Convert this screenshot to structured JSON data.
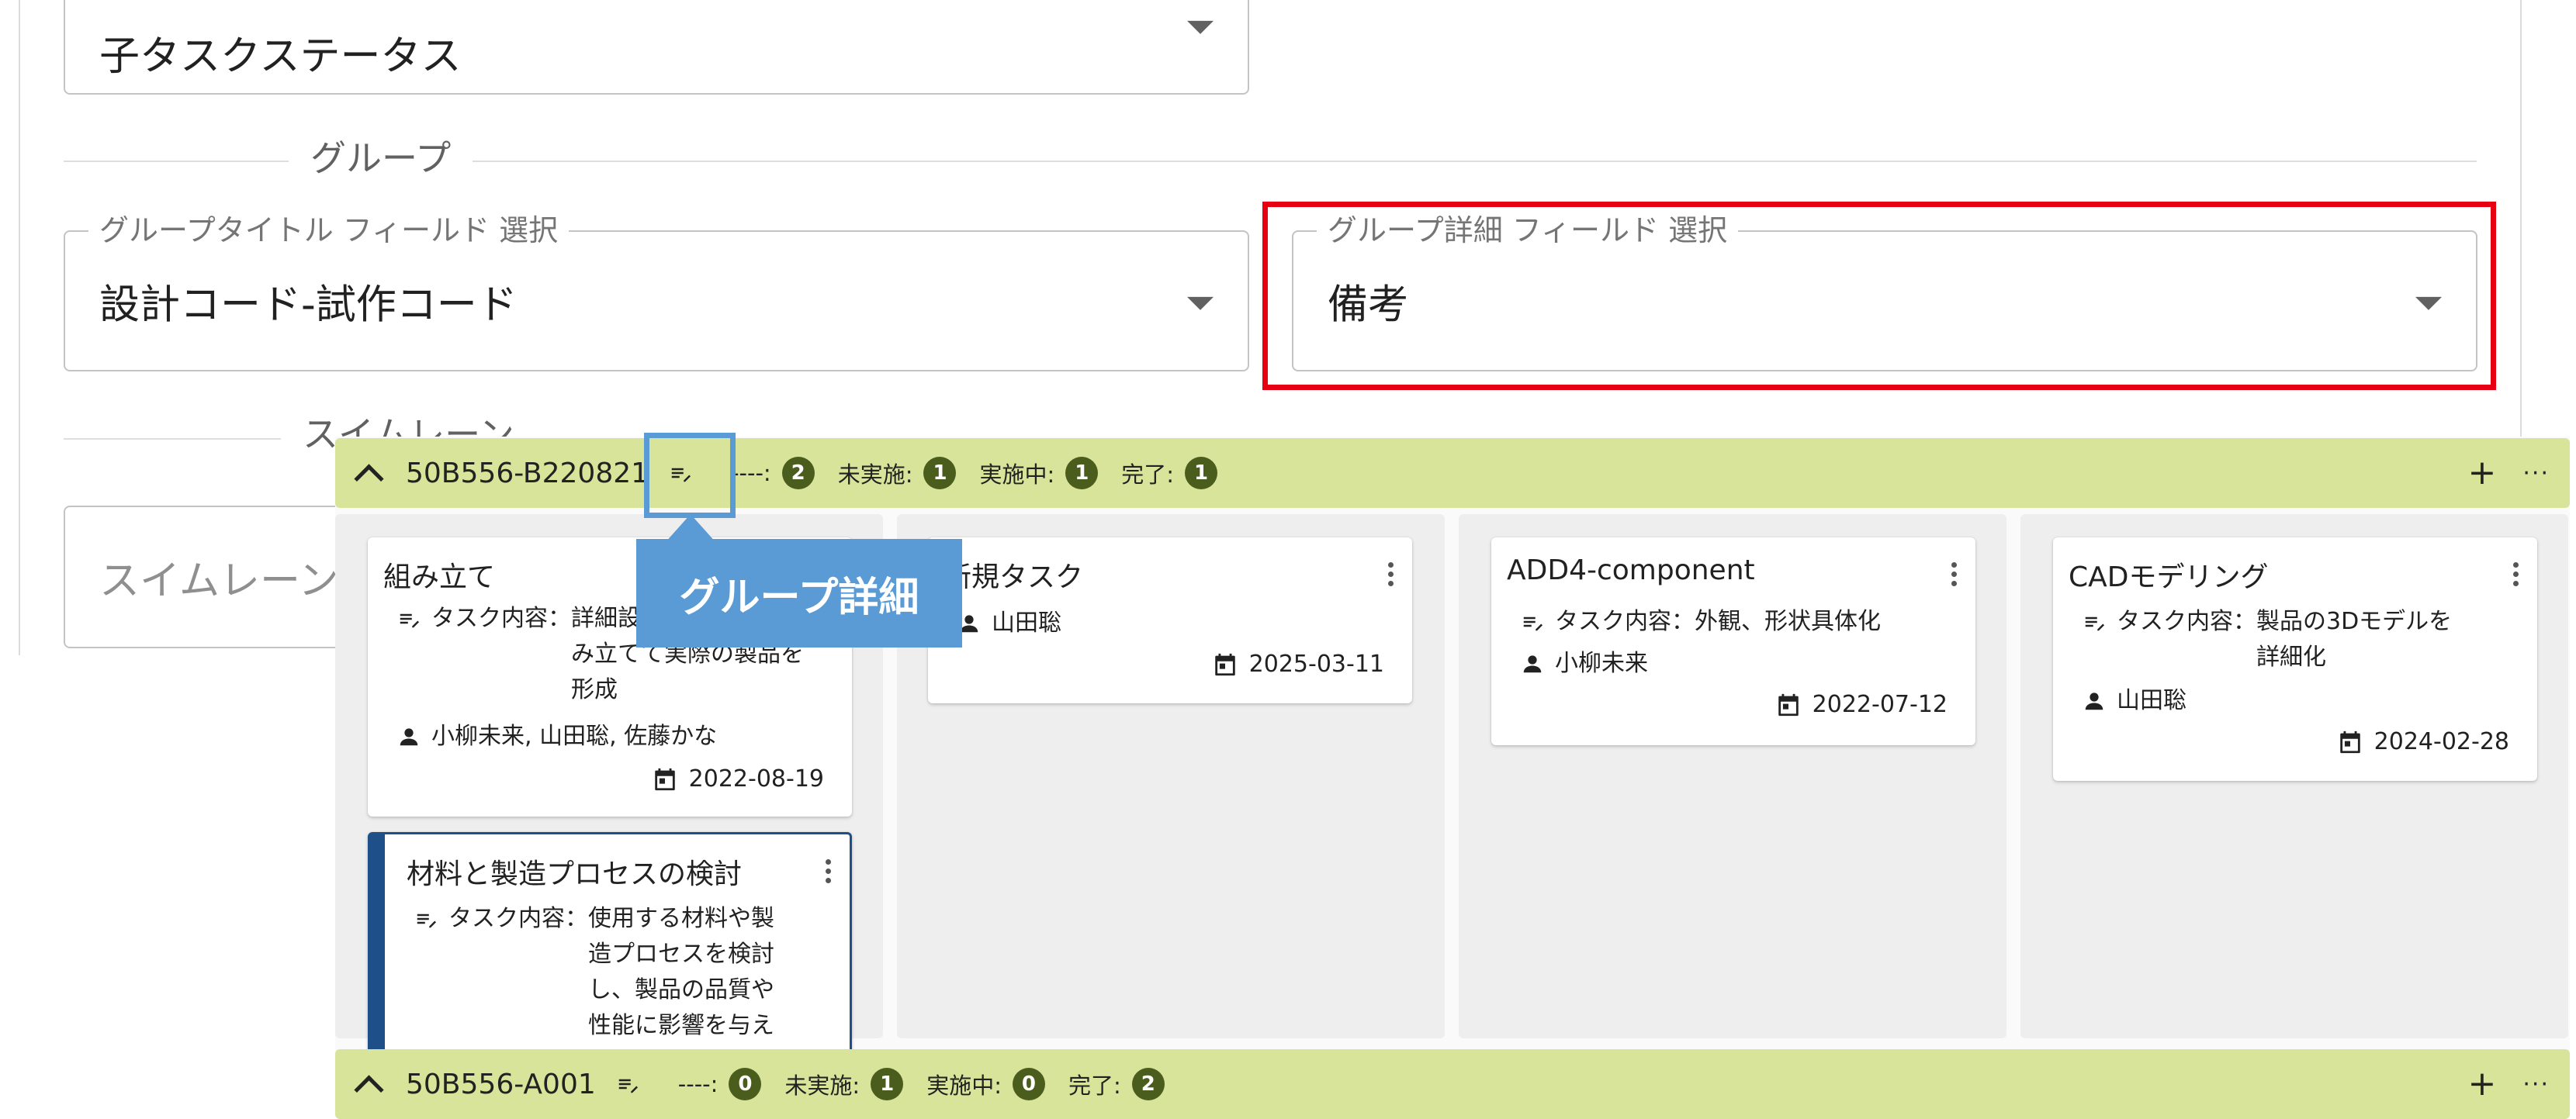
{
  "form": {
    "child_status": {
      "value": "子タスクステータス"
    },
    "group_section_label": "グループ",
    "group_title_field": {
      "legend": "グループタイトル フィールド 選択",
      "value": "設計コード-試作コード"
    },
    "group_detail_field": {
      "legend": "グループ詳細 フィールド 選択",
      "value": "備考"
    },
    "swimlane_section_label": "スイムレーン",
    "swimlane_field": {
      "placeholder": "スイムレーン"
    }
  },
  "tooltip": {
    "text": "グループ詳細"
  },
  "groups": [
    {
      "title": "50B556-B220821",
      "stats": [
        {
          "label": "----:",
          "count": "2"
        },
        {
          "label": "未実施:",
          "count": "1"
        },
        {
          "label": "実施中:",
          "count": "1"
        },
        {
          "label": "完了:",
          "count": "1"
        }
      ]
    },
    {
      "title": "50B556-A001",
      "stats": [
        {
          "label": "----:",
          "count": "0"
        },
        {
          "label": "未実施:",
          "count": "1"
        },
        {
          "label": "実施中:",
          "count": "0"
        },
        {
          "label": "完了:",
          "count": "2"
        }
      ]
    }
  ],
  "cards": {
    "c1": {
      "title": "組み立て",
      "content_key": "タスク内容：",
      "content": "詳細設計に基づいて組み立てて実際の製品を形成",
      "assignees": "小柳未来, 山田聡, 佐藤かな",
      "date": "2022-08-19"
    },
    "c2": {
      "title": "材料と製造プロセスの検討",
      "content_key": "タスク内容：",
      "content": "使用する材料や製造プロセスを検討し、製品の品質や性能に影響を与え",
      "assignees": "",
      "date": ""
    },
    "c3": {
      "title": "新規タスク",
      "assignees": "山田聡",
      "date": "2025-03-11"
    },
    "c4": {
      "title": "ADD4-component",
      "content_key": "タスク内容：",
      "content": "外観、形状具体化",
      "assignees": "小柳未来",
      "date": "2022-07-12"
    },
    "c5": {
      "title": "CADモデリング",
      "content_key": "タスク内容：",
      "content": "製品の3Dモデルを詳細化",
      "assignees": "山田聡",
      "date": "2024-02-28"
    }
  }
}
